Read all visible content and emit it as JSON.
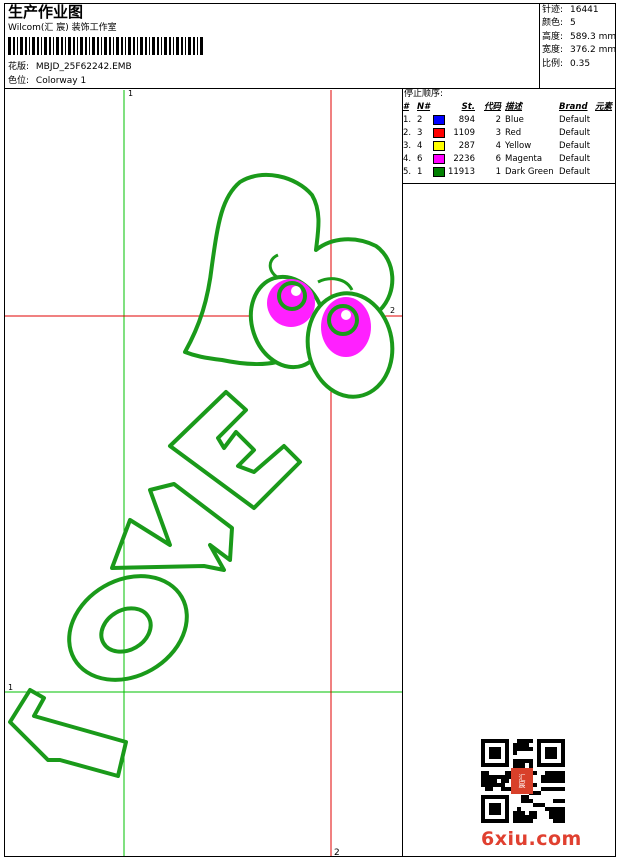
{
  "header": {
    "title": "生产作业图",
    "studio": "Wilcom(汇 宸) 装饰工作室",
    "design_label": "花版:",
    "design_value": "MBJD_25F62242.EMB",
    "colorway_label": "色位:",
    "colorway_value": "Colorway 1"
  },
  "stats": [
    {
      "label": "针迹:",
      "value": "16441"
    },
    {
      "label": "颜色:",
      "value": "5"
    },
    {
      "label": "高度:",
      "value": "589.3 mm"
    },
    {
      "label": "宽度:",
      "value": "376.2 mm"
    },
    {
      "label": "比例:",
      "value": "0.35"
    }
  ],
  "stop_sequence": {
    "title": "停止顺序:",
    "headers": [
      "#",
      "N#",
      "St.",
      "代码",
      "描述",
      "Brand",
      "元素"
    ],
    "rows": [
      {
        "idx": "1.",
        "n": "2",
        "color": "#0000ff",
        "st": "894",
        "code": "2",
        "desc": "Blue",
        "brand": "Default"
      },
      {
        "idx": "2.",
        "n": "3",
        "color": "#ff0000",
        "st": "1109",
        "code": "3",
        "desc": "Red",
        "brand": "Default"
      },
      {
        "idx": "3.",
        "n": "4",
        "color": "#ffff00",
        "st": "287",
        "code": "4",
        "desc": "Yellow",
        "brand": "Default"
      },
      {
        "idx": "4.",
        "n": "6",
        "color": "#ff00ff",
        "st": "2236",
        "code": "6",
        "desc": "Magenta",
        "brand": "Default"
      },
      {
        "idx": "5.",
        "n": "1",
        "color": "#008000",
        "st": "11913",
        "code": "1",
        "desc": "Dark Green",
        "brand": "Default"
      }
    ]
  },
  "guides": {
    "top_label": "1",
    "left_label": "1",
    "right_label": "2",
    "bottom_label": "2"
  },
  "design_colors": {
    "outline": "#1a9a1a",
    "eye_fill": "#ff20ff",
    "guide_red": "#e00000",
    "guide_green": "#00c000"
  },
  "website": "6xiu.com",
  "seal_text": "汇宸"
}
